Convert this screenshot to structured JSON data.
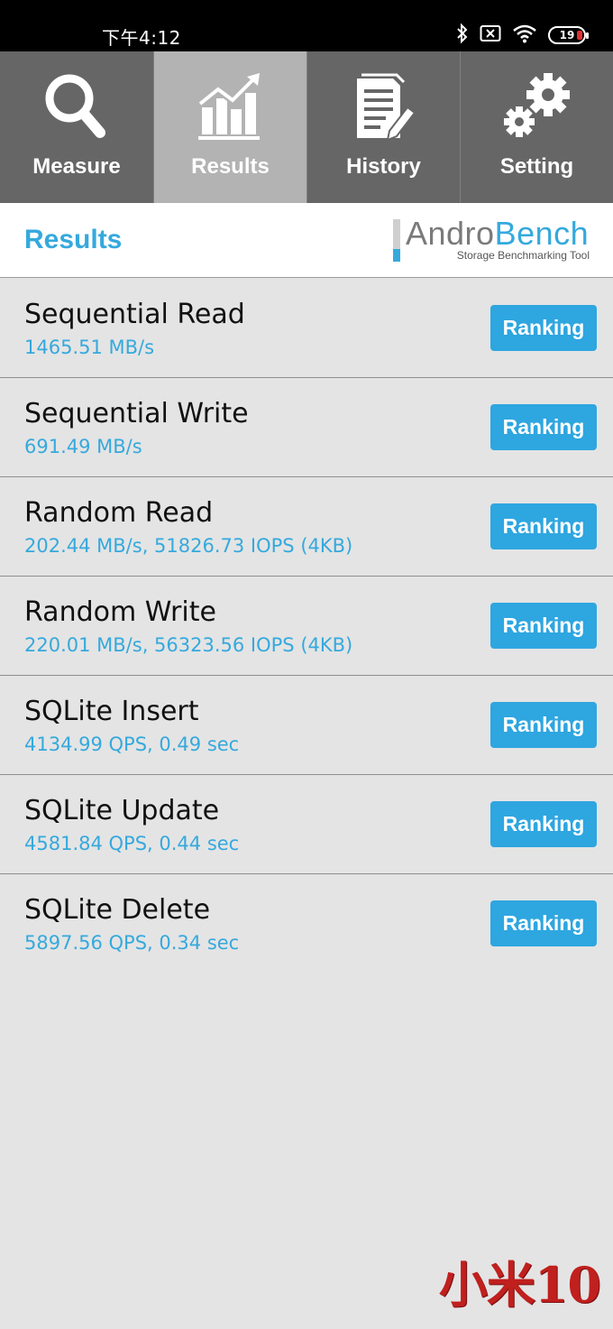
{
  "status_bar": {
    "time": "下午4:12",
    "battery_level": "19",
    "icons": [
      "bluetooth-icon",
      "no-sim-icon",
      "wifi-icon",
      "battery-icon"
    ]
  },
  "tabs": [
    {
      "label": "Measure",
      "icon": "magnifier-icon",
      "active": false
    },
    {
      "label": "Results",
      "icon": "chart-icon",
      "active": true
    },
    {
      "label": "History",
      "icon": "document-icon",
      "active": false
    },
    {
      "label": "Setting",
      "icon": "gears-icon",
      "active": false
    }
  ],
  "header": {
    "title": "Results",
    "logo_andro": "Andro",
    "logo_bench": "Bench",
    "logo_tagline": "Storage Benchmarking Tool"
  },
  "results": [
    {
      "name": "Sequential Read",
      "value": "1465.51 MB/s",
      "button": "Ranking"
    },
    {
      "name": "Sequential Write",
      "value": "691.49 MB/s",
      "button": "Ranking"
    },
    {
      "name": "Random Read",
      "value": "202.44 MB/s, 51826.73 IOPS (4KB)",
      "button": "Ranking"
    },
    {
      "name": "Random Write",
      "value": "220.01 MB/s, 56323.56 IOPS (4KB)",
      "button": "Ranking"
    },
    {
      "name": "SQLite Insert",
      "value": "4134.99 QPS, 0.49 sec",
      "button": "Ranking"
    },
    {
      "name": "SQLite Update",
      "value": "4581.84 QPS, 0.44 sec",
      "button": "Ranking"
    },
    {
      "name": "SQLite Delete",
      "value": "5897.56 QPS, 0.34 sec",
      "button": "Ranking"
    }
  ],
  "watermark": "小米10",
  "colors": {
    "accent": "#35a9dd",
    "button": "#2ea6e0",
    "tab_bg": "#666666",
    "tab_active": "#b3b3b3",
    "list_bg": "#e4e4e4",
    "watermark": "#c0201e"
  }
}
